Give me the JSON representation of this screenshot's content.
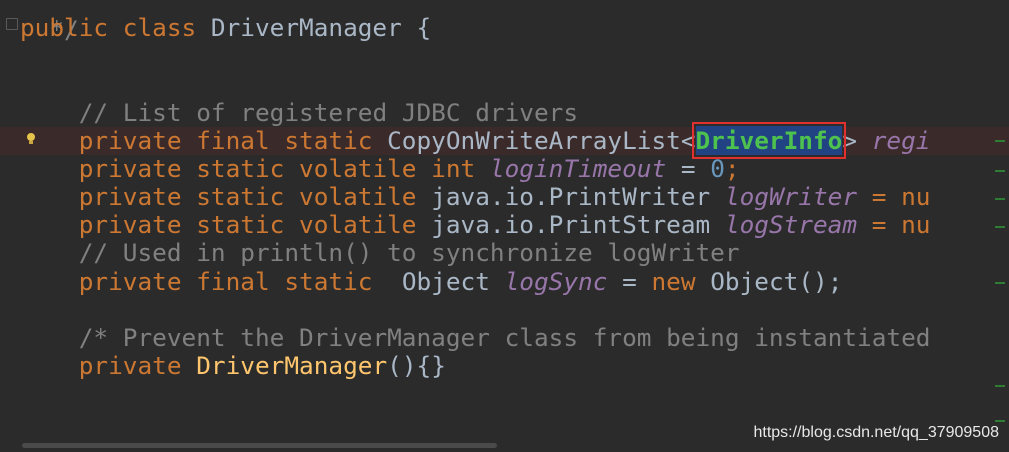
{
  "editor": {
    "lines": {
      "l0": {
        "comment_end": "*/"
      },
      "l1": {
        "kw": "public class ",
        "name": "DriverManager",
        "rest": " {"
      },
      "l4": {
        "comment": "// List of registered JDBC drivers"
      },
      "l5": {
        "kw": "private final static ",
        "type": "CopyOnWriteArrayList<",
        "generic": "DriverInfo",
        "close": "> ",
        "field": "regi"
      },
      "l6": {
        "kw": "private static volatile int ",
        "field": "loginTimeout",
        "eq": " = ",
        "num": "0",
        "semi": ";"
      },
      "l7": {
        "kw": "private static volatile ",
        "type": "java.io.PrintWriter ",
        "field": "logWriter",
        "rest": " = nu"
      },
      "l8": {
        "kw": "private static volatile ",
        "type": "java.io.PrintStream ",
        "field": "logStream",
        "rest": " = nu"
      },
      "l9": {
        "comment": "// Used in println() to synchronize logWriter"
      },
      "l10": {
        "kw": "private final static  ",
        "type": "Object ",
        "field": "logSync",
        "eq": " = ",
        "kw2": "new ",
        "rest": "Object();"
      },
      "l12": {
        "comment": "/* Prevent the DriverManager class from being instantiated"
      },
      "l13": {
        "kw": "private ",
        "fn": "DriverManager",
        "rest": "(){}"
      }
    }
  },
  "watermark": "https://blog.csdn.net/qq_37909508",
  "colors": {
    "keyword": "#cc7832",
    "comment": "#808080",
    "field": "#9876aa",
    "method": "#ffc66d",
    "number": "#6897bb",
    "highlight_box": "#e03030"
  }
}
